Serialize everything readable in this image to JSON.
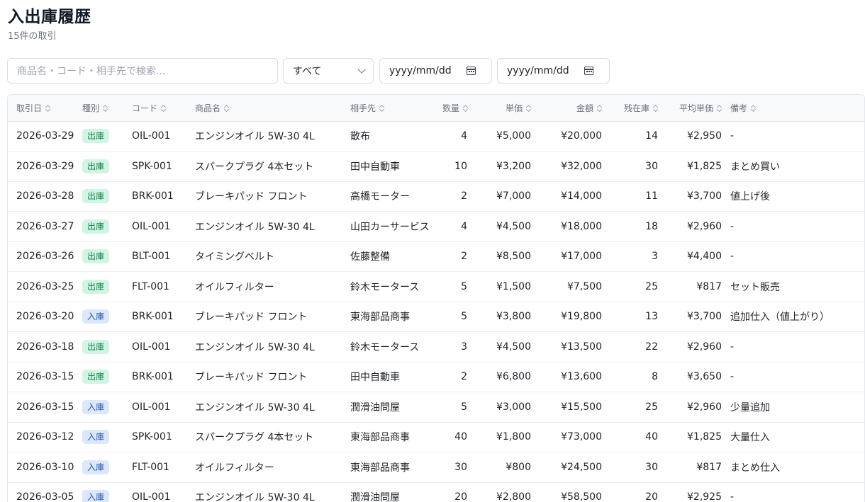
{
  "header": {
    "title": "入出庫履歴",
    "subtitle": "15件の取引"
  },
  "filters": {
    "search_placeholder": "商品名・コード・相手先で検索...",
    "type_selected": "すべて",
    "date_from_placeholder": "yyyy/mm/dd",
    "date_to_placeholder": "yyyy/mm/dd"
  },
  "table": {
    "columns": [
      "取引日",
      "種別",
      "コード",
      "商品名",
      "相手先",
      "数量",
      "単価",
      "金額",
      "残在庫",
      "平均単価",
      "備考"
    ],
    "rows": [
      {
        "date": "2026-03-29",
        "type": "出庫",
        "kind": "out",
        "code": "OIL-001",
        "name": "エンジンオイル 5W-30 4L",
        "partner": "散布",
        "qty": "4",
        "price": "¥5,000",
        "amount": "¥20,000",
        "stock": "14",
        "avg": "¥2,950",
        "note": "-"
      },
      {
        "date": "2026-03-29",
        "type": "出庫",
        "kind": "out",
        "code": "SPK-001",
        "name": "スパークプラグ 4本セット",
        "partner": "田中自動車",
        "qty": "10",
        "price": "¥3,200",
        "amount": "¥32,000",
        "stock": "30",
        "avg": "¥1,825",
        "note": "まとめ買い"
      },
      {
        "date": "2026-03-28",
        "type": "出庫",
        "kind": "out",
        "code": "BRK-001",
        "name": "ブレーキパッド フロント",
        "partner": "高橋モーター",
        "qty": "2",
        "price": "¥7,000",
        "amount": "¥14,000",
        "stock": "11",
        "avg": "¥3,700",
        "note": "値上げ後"
      },
      {
        "date": "2026-03-27",
        "type": "出庫",
        "kind": "out",
        "code": "OIL-001",
        "name": "エンジンオイル 5W-30 4L",
        "partner": "山田カーサービス",
        "qty": "4",
        "price": "¥4,500",
        "amount": "¥18,000",
        "stock": "18",
        "avg": "¥2,960",
        "note": "-"
      },
      {
        "date": "2026-03-26",
        "type": "出庫",
        "kind": "out",
        "code": "BLT-001",
        "name": "タイミングベルト",
        "partner": "佐藤整備",
        "qty": "2",
        "price": "¥8,500",
        "amount": "¥17,000",
        "stock": "3",
        "avg": "¥4,400",
        "note": "-"
      },
      {
        "date": "2026-03-25",
        "type": "出庫",
        "kind": "out",
        "code": "FLT-001",
        "name": "オイルフィルター",
        "partner": "鈴木モータース",
        "qty": "5",
        "price": "¥1,500",
        "amount": "¥7,500",
        "stock": "25",
        "avg": "¥817",
        "note": "セット販売"
      },
      {
        "date": "2026-03-20",
        "type": "入庫",
        "kind": "in",
        "code": "BRK-001",
        "name": "ブレーキパッド フロント",
        "partner": "東海部品商事",
        "qty": "5",
        "price": "¥3,800",
        "amount": "¥19,800",
        "stock": "13",
        "avg": "¥3,700",
        "note": "追加仕入（値上がり）"
      },
      {
        "date": "2026-03-18",
        "type": "出庫",
        "kind": "out",
        "code": "OIL-001",
        "name": "エンジンオイル 5W-30 4L",
        "partner": "鈴木モータース",
        "qty": "3",
        "price": "¥4,500",
        "amount": "¥13,500",
        "stock": "22",
        "avg": "¥2,960",
        "note": "-"
      },
      {
        "date": "2026-03-15",
        "type": "出庫",
        "kind": "out",
        "code": "BRK-001",
        "name": "ブレーキパッド フロント",
        "partner": "田中自動車",
        "qty": "2",
        "price": "¥6,800",
        "amount": "¥13,600",
        "stock": "8",
        "avg": "¥3,650",
        "note": "-"
      },
      {
        "date": "2026-03-15",
        "type": "入庫",
        "kind": "in",
        "code": "OIL-001",
        "name": "エンジンオイル 5W-30 4L",
        "partner": "潤滑油問屋",
        "qty": "5",
        "price": "¥3,000",
        "amount": "¥15,500",
        "stock": "25",
        "avg": "¥2,960",
        "note": "少量追加"
      },
      {
        "date": "2026-03-12",
        "type": "入庫",
        "kind": "in",
        "code": "SPK-001",
        "name": "スパークプラグ 4本セット",
        "partner": "東海部品商事",
        "qty": "40",
        "price": "¥1,800",
        "amount": "¥73,000",
        "stock": "40",
        "avg": "¥1,825",
        "note": "大量仕入"
      },
      {
        "date": "2026-03-10",
        "type": "入庫",
        "kind": "in",
        "code": "FLT-001",
        "name": "オイルフィルター",
        "partner": "東海部品商事",
        "qty": "30",
        "price": "¥800",
        "amount": "¥24,500",
        "stock": "30",
        "avg": "¥817",
        "note": "まとめ仕入"
      },
      {
        "date": "2026-03-05",
        "type": "入庫",
        "kind": "in",
        "code": "OIL-001",
        "name": "エンジンオイル 5W-30 4L",
        "partner": "潤滑油問屋",
        "qty": "20",
        "price": "¥2,800",
        "amount": "¥58,500",
        "stock": "20",
        "avg": "¥2,925",
        "note": "-"
      }
    ]
  },
  "colors": {
    "out_badge_bg": "#d1f5e3",
    "out_badge_text": "#14804a",
    "in_badge_bg": "#dbe7fb",
    "in_badge_text": "#2757b8"
  }
}
